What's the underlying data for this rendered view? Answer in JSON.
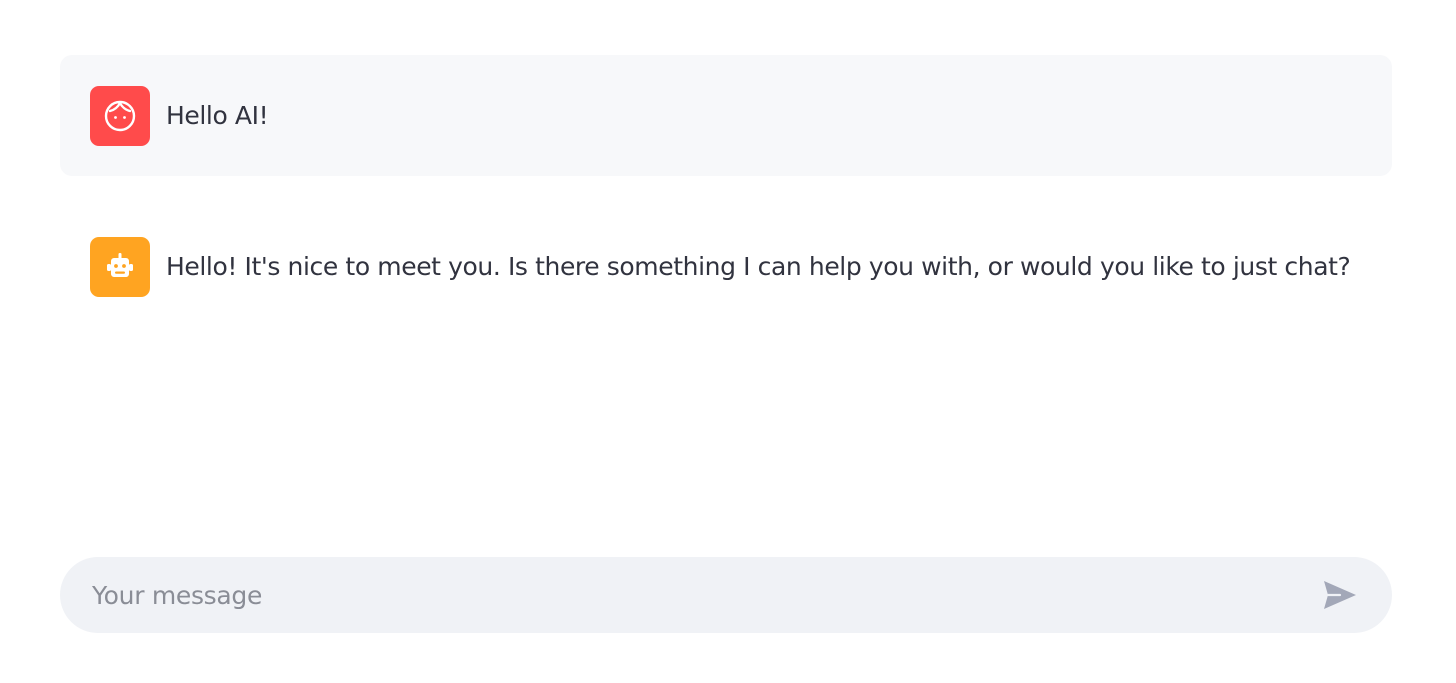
{
  "messages": [
    {
      "role": "user",
      "avatar_icon": "user-face-icon",
      "avatar_color": "#ff4b4b",
      "text": "Hello AI!"
    },
    {
      "role": "assistant",
      "avatar_icon": "robot-icon",
      "avatar_color": "#ffa421",
      "text": "Hello! It's nice to meet you. Is there something I can help you with, or would you like to just chat?"
    }
  ],
  "chat_input": {
    "value": "",
    "placeholder": "Your message",
    "send_icon": "send-icon",
    "send_icon_color": "#a3a8b8"
  }
}
